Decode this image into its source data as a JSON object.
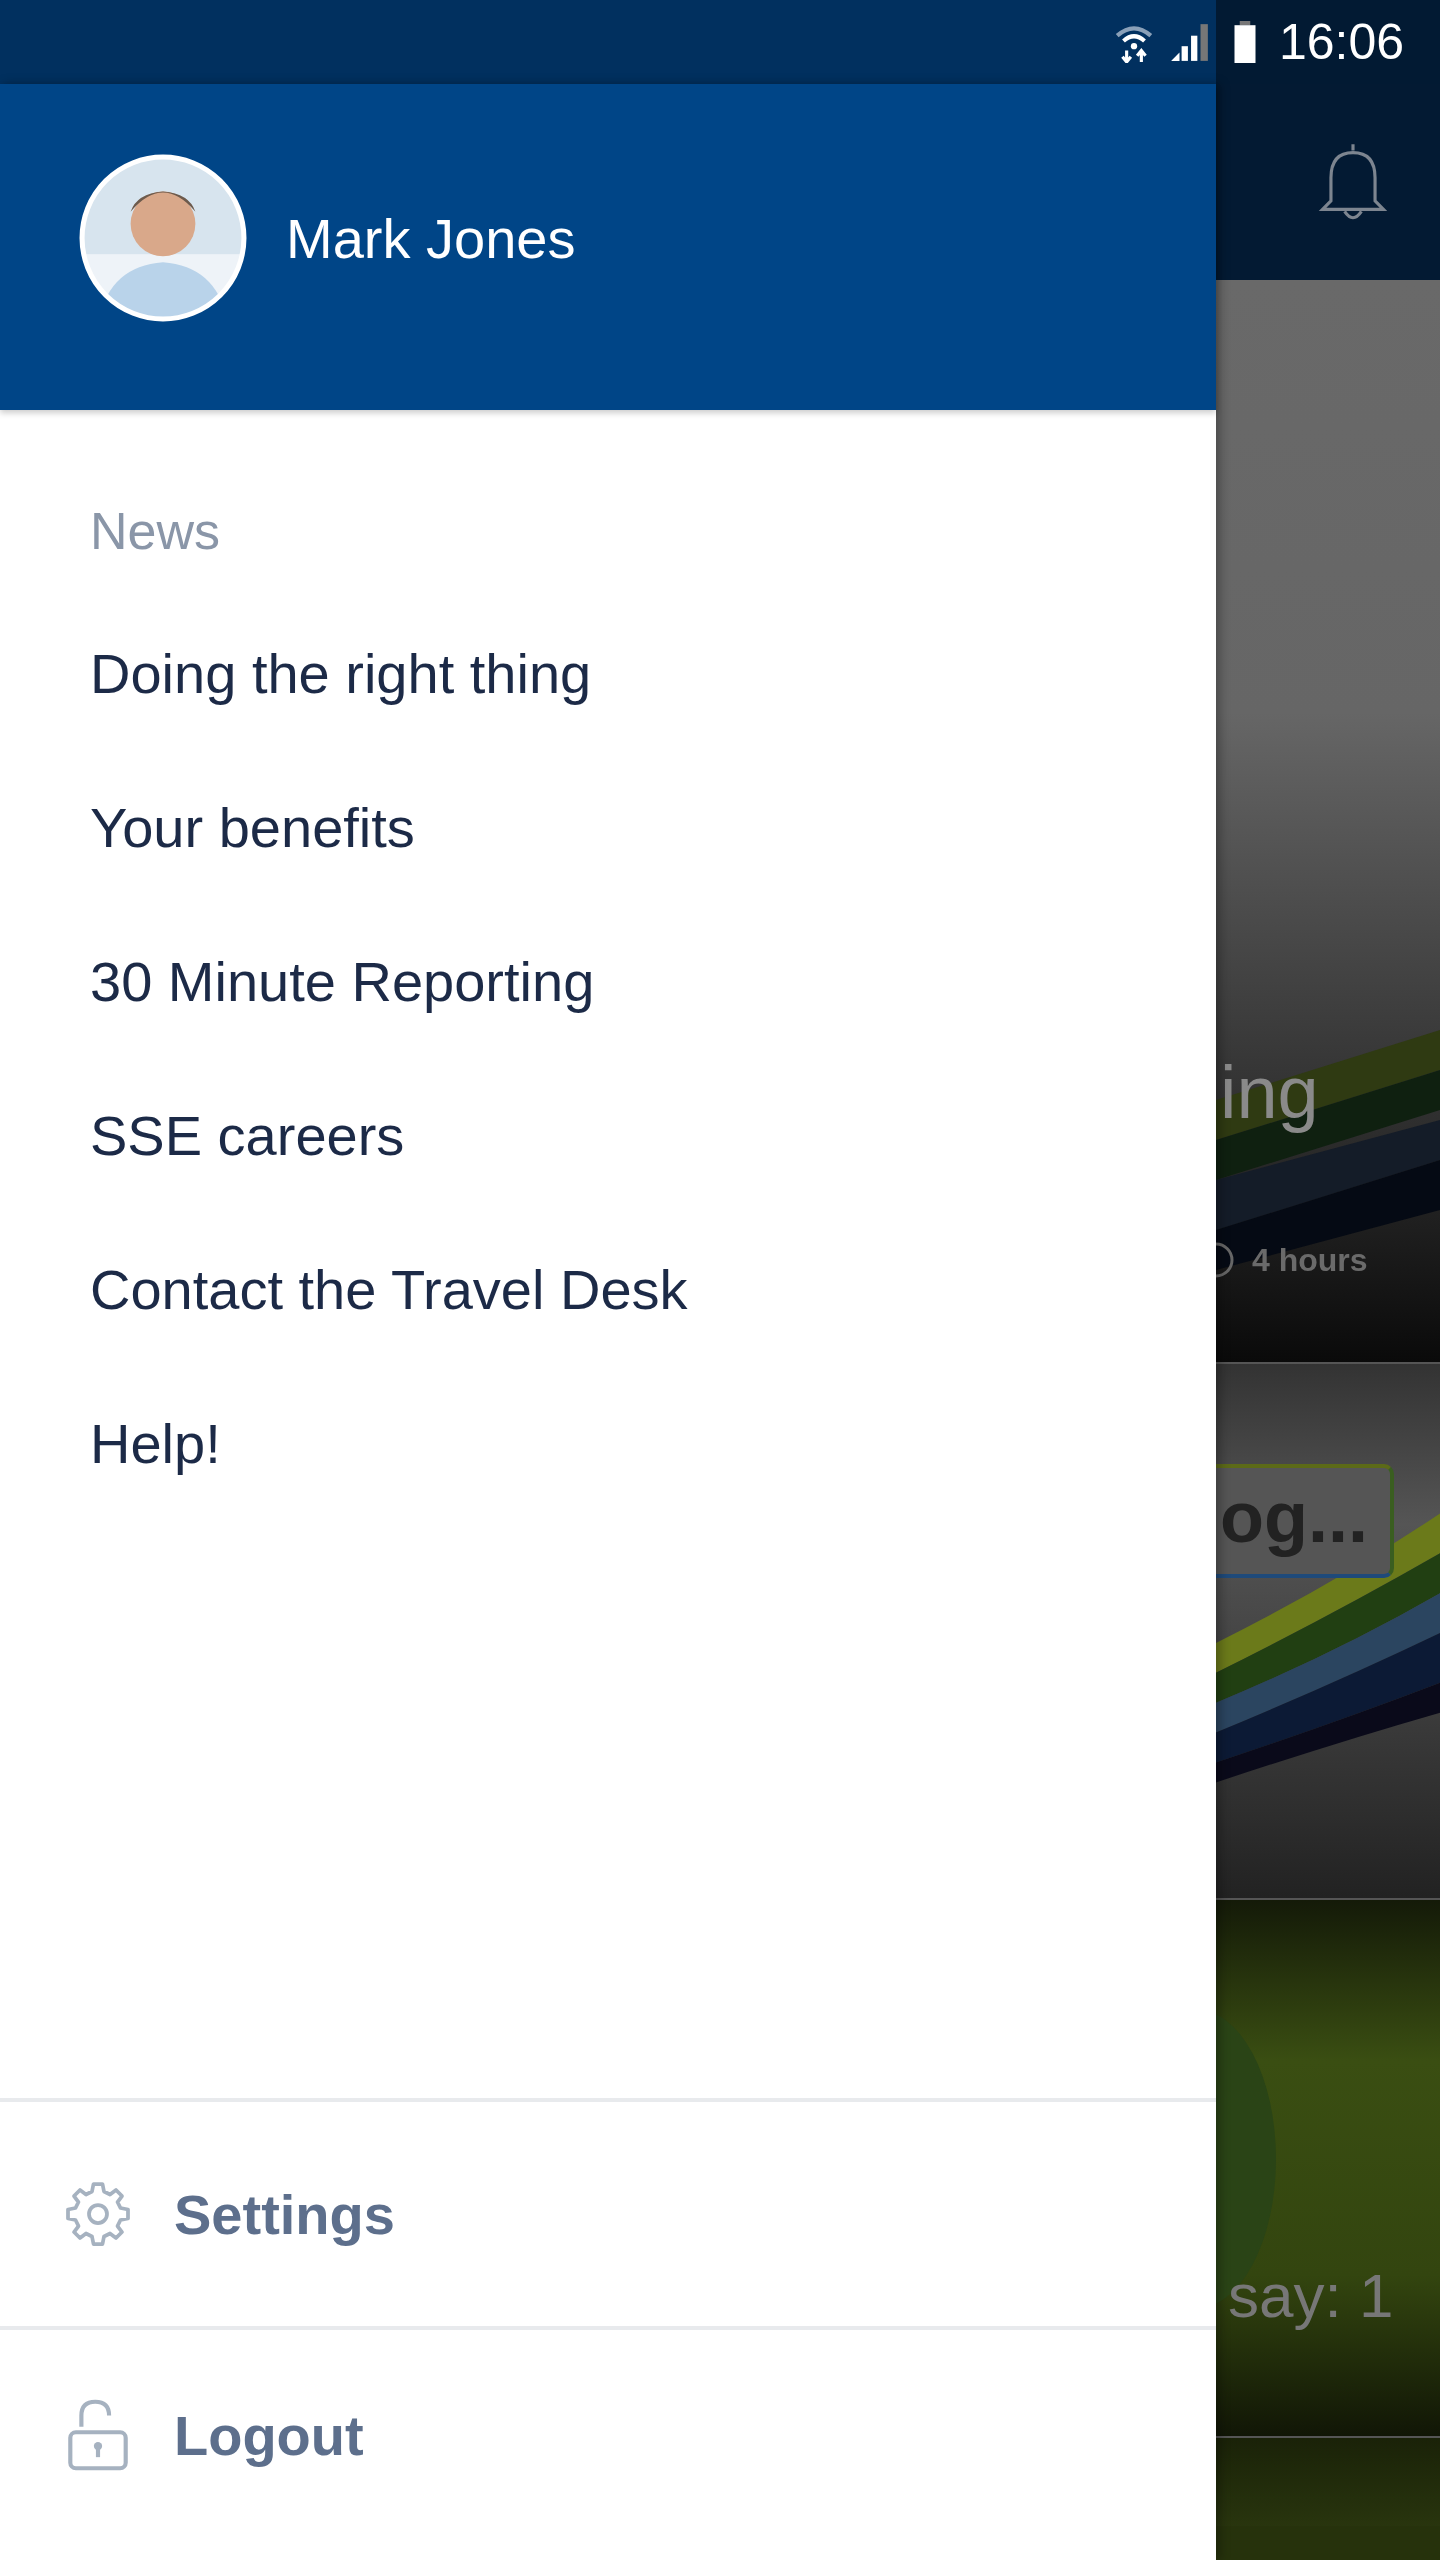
{
  "status_bar": {
    "time": "16:06"
  },
  "drawer": {
    "user": {
      "name": "Mark Jones"
    },
    "section": "News",
    "items": [
      {
        "label": "Doing the right thing"
      },
      {
        "label": "Your benefits"
      },
      {
        "label": "30 Minute Reporting"
      },
      {
        "label": "SSE careers"
      },
      {
        "label": "Contact the Travel Desk"
      },
      {
        "label": "Help!"
      }
    ],
    "footer": [
      {
        "kind": "settings",
        "label": "Settings"
      },
      {
        "kind": "logout",
        "label": "Logout"
      }
    ]
  },
  "background": {
    "cards": [
      {
        "kind": "article",
        "title": "ing",
        "time": "4 hours"
      },
      {
        "kind": "banner",
        "badge": "og..."
      },
      {
        "kind": "comment",
        "caption": "say: 1"
      },
      {
        "kind": "plain"
      }
    ]
  }
}
